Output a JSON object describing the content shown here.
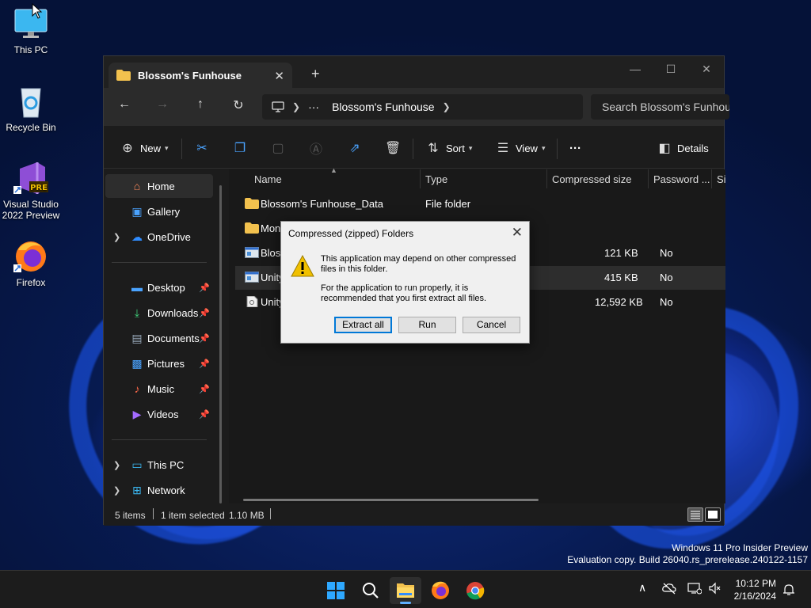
{
  "desktop": {
    "icons": [
      {
        "label": "This PC",
        "icon": "monitor-icon"
      },
      {
        "label": "Recycle Bin",
        "icon": "recycle-bin-icon"
      },
      {
        "label_line1": "Visual Studio",
        "label_line2": "2022 Preview",
        "icon": "visual-studio-icon",
        "badge": "PRE"
      },
      {
        "label": "Firefox",
        "icon": "firefox-icon"
      }
    ],
    "watermark_line1": "Windows 11 Pro Insider Preview",
    "watermark_line2": "Evaluation copy. Build 26040.rs_prerelease.240122-1157"
  },
  "explorer": {
    "tab_title": "Blossom's Funhouse",
    "window_controls": {
      "minimize": "—",
      "maximize": "☐",
      "close": "✕"
    },
    "nav": {
      "back": "←",
      "forward": "→",
      "up": "↑",
      "refresh": "↻"
    },
    "address": {
      "more": "···",
      "crumb": "Blossom's Funhouse"
    },
    "search_placeholder": "Search Blossom's Funhouse",
    "toolbar": {
      "new_label": "New",
      "sort_label": "Sort",
      "view_label": "View",
      "more_label": "···",
      "details_label": "Details"
    },
    "navpane": {
      "top": [
        {
          "label": "Home",
          "icon": "home-icon"
        },
        {
          "label": "Gallery",
          "icon": "gallery-icon"
        },
        {
          "label": "OneDrive",
          "icon": "onedrive-icon"
        }
      ],
      "pinned": [
        {
          "label": "Desktop",
          "icon": "desktop-folder-icon"
        },
        {
          "label": "Downloads",
          "icon": "downloads-icon"
        },
        {
          "label": "Documents",
          "icon": "documents-icon"
        },
        {
          "label": "Pictures",
          "icon": "pictures-icon"
        },
        {
          "label": "Music",
          "icon": "music-icon"
        },
        {
          "label": "Videos",
          "icon": "videos-icon"
        }
      ],
      "bottom": [
        {
          "label": "This PC",
          "icon": "this-pc-icon"
        },
        {
          "label": "Network",
          "icon": "network-icon"
        }
      ]
    },
    "columns": [
      "Name",
      "Type",
      "Compressed size",
      "Password ...",
      "Si"
    ],
    "rows": [
      {
        "name": "Blossom's Funhouse_Data",
        "type": "File folder",
        "size": "",
        "password": "",
        "icon": "folder-icon"
      },
      {
        "name": "Mono",
        "type": "",
        "size": "",
        "password": "",
        "icon": "folder-icon"
      },
      {
        "name": "Bloss",
        "type": "",
        "size": "121 KB",
        "password": "No",
        "icon": "application-icon"
      },
      {
        "name": "Unity",
        "type": "",
        "size": "415 KB",
        "password": "No",
        "icon": "application-icon"
      },
      {
        "name": "Unity",
        "type": "",
        "size": "12,592 KB",
        "password": "No",
        "icon": "file-icon"
      }
    ],
    "status": {
      "items": "5 items",
      "selected": "1 item selected",
      "size": "1.10 MB"
    }
  },
  "dialog": {
    "title": "Compressed (zipped) Folders",
    "message1": "This application may depend on other compressed files in this folder.",
    "message2": "For the application to run properly, it is recommended that you first extract all files.",
    "buttons": {
      "extract": "Extract all",
      "run": "Run",
      "cancel": "Cancel"
    }
  },
  "taskbar": {
    "time": "10:12 PM",
    "date": "2/16/2024",
    "tray_chevron": "∧"
  },
  "colors": {
    "accent": "#4aa3ff",
    "folder": "#f2c14e",
    "warning": "#f0c000"
  }
}
